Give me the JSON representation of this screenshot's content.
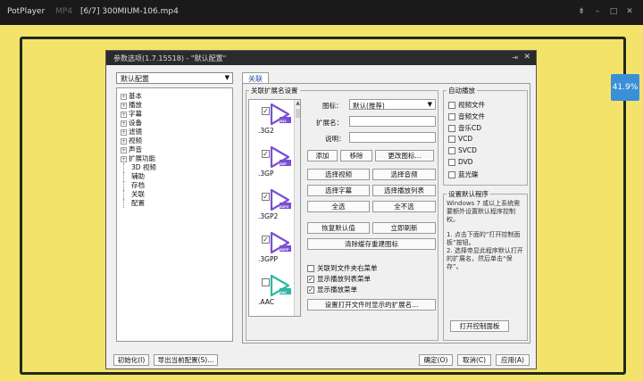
{
  "player": {
    "app_name": "PotPlayer",
    "format": "MP4",
    "file_title": "[6/7] 300MIUM-106.mp4",
    "progress_badge": "41.9%"
  },
  "dialog": {
    "title": "参数选项(1.7.15518) - \"默认配置\"",
    "preset": "默认配置",
    "tab_label": "关联"
  },
  "tree": [
    {
      "label": "基本",
      "expand": "+"
    },
    {
      "label": "播放",
      "expand": "+"
    },
    {
      "label": "字幕",
      "expand": "+"
    },
    {
      "label": "设备",
      "expand": "+"
    },
    {
      "label": "滤镜",
      "expand": "+"
    },
    {
      "label": "视频",
      "expand": "+"
    },
    {
      "label": "声音",
      "expand": "+"
    },
    {
      "label": "扩展功能",
      "expand": "+"
    },
    {
      "label": "3D 视频",
      "expand": ""
    },
    {
      "label": "辅助",
      "expand": ""
    },
    {
      "label": "存档",
      "expand": ""
    },
    {
      "label": "关联",
      "expand": ""
    },
    {
      "label": "配置",
      "expand": ""
    }
  ],
  "assoc": {
    "group_label": "关联扩展名设置",
    "extensions": [
      {
        "name": ".3G2",
        "badge": "3G2",
        "color": "#7a4fd0",
        "checked": "✓"
      },
      {
        "name": ".3GP",
        "badge": "3GP",
        "color": "#7a4fd0",
        "checked": "✓"
      },
      {
        "name": ".3GP2",
        "badge": "3GP2",
        "color": "#7a4fd0",
        "checked": "✓"
      },
      {
        "name": ".3GPP",
        "badge": "3GPP",
        "color": "#7a4fd0",
        "checked": "✓"
      },
      {
        "name": ".AAC",
        "badge": "AAC",
        "color": "#2eb8a0",
        "checked": ""
      },
      {
        "name": "",
        "badge": "",
        "color": "#2eb8a0",
        "checked": ""
      }
    ],
    "icon_label": "图标：",
    "icon_value": "默认(推荐)",
    "ext_label": "扩展名：",
    "desc_label": "说明：",
    "buttons": {
      "add": "添加",
      "remove": "移除",
      "change_icon": "更改图标...",
      "select_video": "选择视频",
      "select_audio": "选择音频",
      "select_subtitle": "选择字幕",
      "select_playlist": "选择播放列表",
      "select_all": "全选",
      "select_none": "全不选",
      "restore_default": "恢复默认值",
      "refresh_now": "立即刷新",
      "clear_cache": "清除缓存重建图标",
      "set_ext_on_open": "设置打开文件时显示的扩展名..."
    },
    "options": [
      {
        "label": "关联到文件夹右菜单",
        "checked": ""
      },
      {
        "label": "显示播放列表菜单",
        "checked": "✓"
      },
      {
        "label": "显示播放菜单",
        "checked": "✓"
      }
    ]
  },
  "autoplay": {
    "label": "自动播放",
    "items": [
      "视频文件",
      "音频文件",
      "音乐CD",
      "VCD",
      "SVCD",
      "DVD",
      "蓝光碟"
    ]
  },
  "default_prog": {
    "label": "设置默认程序",
    "text1": "Windows 7 或以上系统需要额外设置默认程序控制权。",
    "text2": "1. 点击下面的“打开控制面板”按钮。",
    "text3": "2. 选择帝显此程序默认打开的扩展名，然后单击“保存”。",
    "open_panel": "打开控制面板"
  },
  "bottom": {
    "init": "初始化(I)",
    "export": "导出当前配置(S)...",
    "ok": "确定(O)",
    "cancel": "取消(C)",
    "apply": "应用(A)"
  },
  "colors": {
    "video_bg": "#f4e36b",
    "accent": "#3b8fd8"
  }
}
